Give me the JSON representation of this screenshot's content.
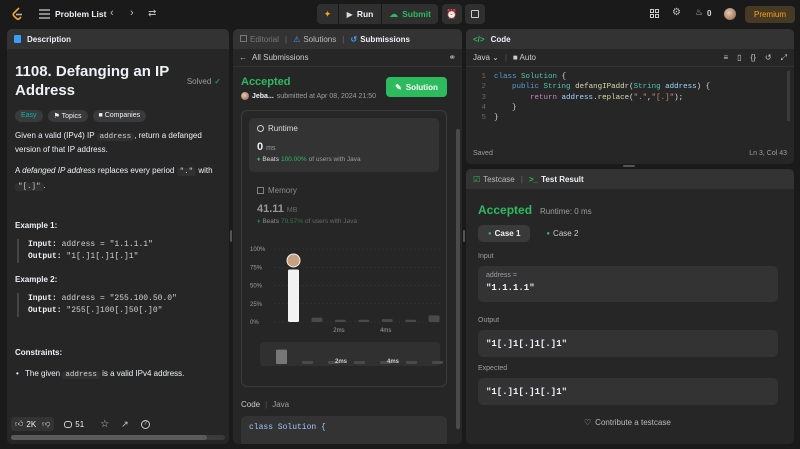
{
  "topbar": {
    "problem_list": "Problem List",
    "run": "Run",
    "submit": "Submit",
    "streak": "0",
    "premium": "Premium"
  },
  "description": {
    "tab": "Description",
    "title": "1108. Defanging an IP Address",
    "status": "Solved",
    "tags": [
      "Easy",
      "Topics",
      "Companies"
    ],
    "p1_a": "Given a valid (IPv4) IP ",
    "p1_code": "address",
    "p1_b": ", return a defanged version of that IP address.",
    "p2_a": "A ",
    "p2_em": "defanged IP address",
    "p2_b": " replaces every period ",
    "p2_code1": "\".\"",
    "p2_c": " with ",
    "p2_code2": "\"[.]\"",
    "p2_d": ".",
    "ex1_title": "Example 1:",
    "ex1_in_label": "Input:",
    "ex1_in": "address = \"1.1.1.1\"",
    "ex1_out_label": "Output:",
    "ex1_out": "\"1[.]1[.]1[.]1\"",
    "ex2_title": "Example 2:",
    "ex2_in_label": "Input:",
    "ex2_in": "address = \"255.100.50.0\"",
    "ex2_out_label": "Output:",
    "ex2_out": "\"255[.]100[.]50[.]0\"",
    "constraints_title": "Constraints:",
    "c1_a": "The given ",
    "c1_code": "address",
    "c1_b": " is a valid IPv4 address.",
    "likes": "2K",
    "comments": "51"
  },
  "submissions": {
    "tabs": [
      "Editorial",
      "Solutions",
      "Submissions"
    ],
    "back": "All Submissions",
    "result": "Accepted",
    "user": "Jeba...",
    "submitted": "submitted at Apr 08, 2024 21:50",
    "solution_btn": "Solution",
    "runtime_label": "Runtime",
    "runtime_value": "0",
    "runtime_unit": "ms",
    "runtime_beats_a": "Beats ",
    "runtime_beats_pct": "100.00%",
    "runtime_beats_b": " of users with Java",
    "memory_label": "Memory",
    "memory_value": "41.11",
    "memory_unit": "MB",
    "memory_beats_a": "Beats ",
    "memory_beats_pct": "79.57%",
    "memory_beats_b": " of users with Java",
    "code_label": "Code",
    "code_lang": "Java",
    "code_line": "class Solution {"
  },
  "chart_data": {
    "type": "bar",
    "yticks": [
      "100%",
      "75%",
      "50%",
      "25%",
      "0%"
    ],
    "xticks": [
      "2ms",
      "4ms"
    ],
    "values": [
      72,
      6,
      3,
      3,
      4,
      3,
      9
    ],
    "highlight_index": 0,
    "ylim": [
      0,
      100
    ]
  },
  "editor": {
    "tab": "Code",
    "lang": "Java",
    "mode": "Auto",
    "line_numbers": [
      "1",
      "2",
      "3",
      "4",
      "5"
    ],
    "status_left": "Saved",
    "status_right": "Ln 3, Col 43"
  },
  "results": {
    "tabs": [
      "Testcase",
      "Test Result"
    ],
    "verdict": "Accepted",
    "runtime": "Runtime: 0 ms",
    "cases": [
      "Case 1",
      "Case 2"
    ],
    "input_label": "Input",
    "input_var": "address =",
    "input_val": "\"1.1.1.1\"",
    "output_label": "Output",
    "output_val": "\"1[.]1[.]1[.]1\"",
    "expected_label": "Expected",
    "expected_val": "\"1[.]1[.]1[.]1\"",
    "contribute": "Contribute a testcase"
  },
  "colors": {
    "accent": "#ffa116",
    "green": "#2cbb5d",
    "easy": "#00b8a3",
    "blue": "#3b9cff"
  }
}
